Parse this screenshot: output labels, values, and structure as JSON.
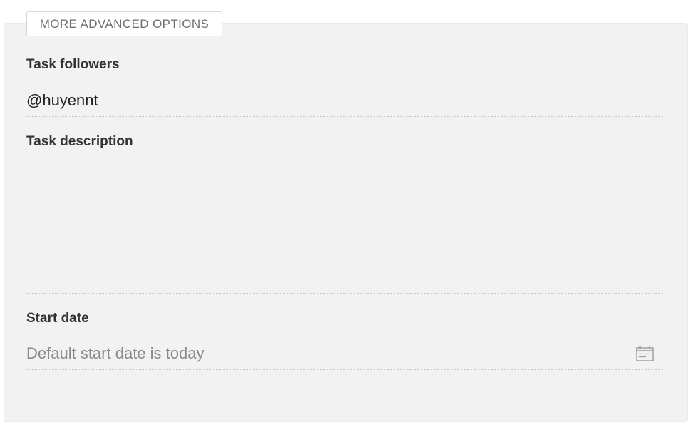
{
  "advanced_options": {
    "label": "MORE ADVANCED OPTIONS"
  },
  "task_followers": {
    "label": "Task followers",
    "value": "@huyennt"
  },
  "task_description": {
    "label": "Task description",
    "value": ""
  },
  "start_date": {
    "label": "Start date",
    "value": "",
    "placeholder": "Default start date is today",
    "icon": "calendar-icon"
  },
  "colors": {
    "panel_background": "#f2f2f2",
    "label_text": "#333333",
    "placeholder_text": "#8a8a8a",
    "divider": "#c9c9c9"
  }
}
